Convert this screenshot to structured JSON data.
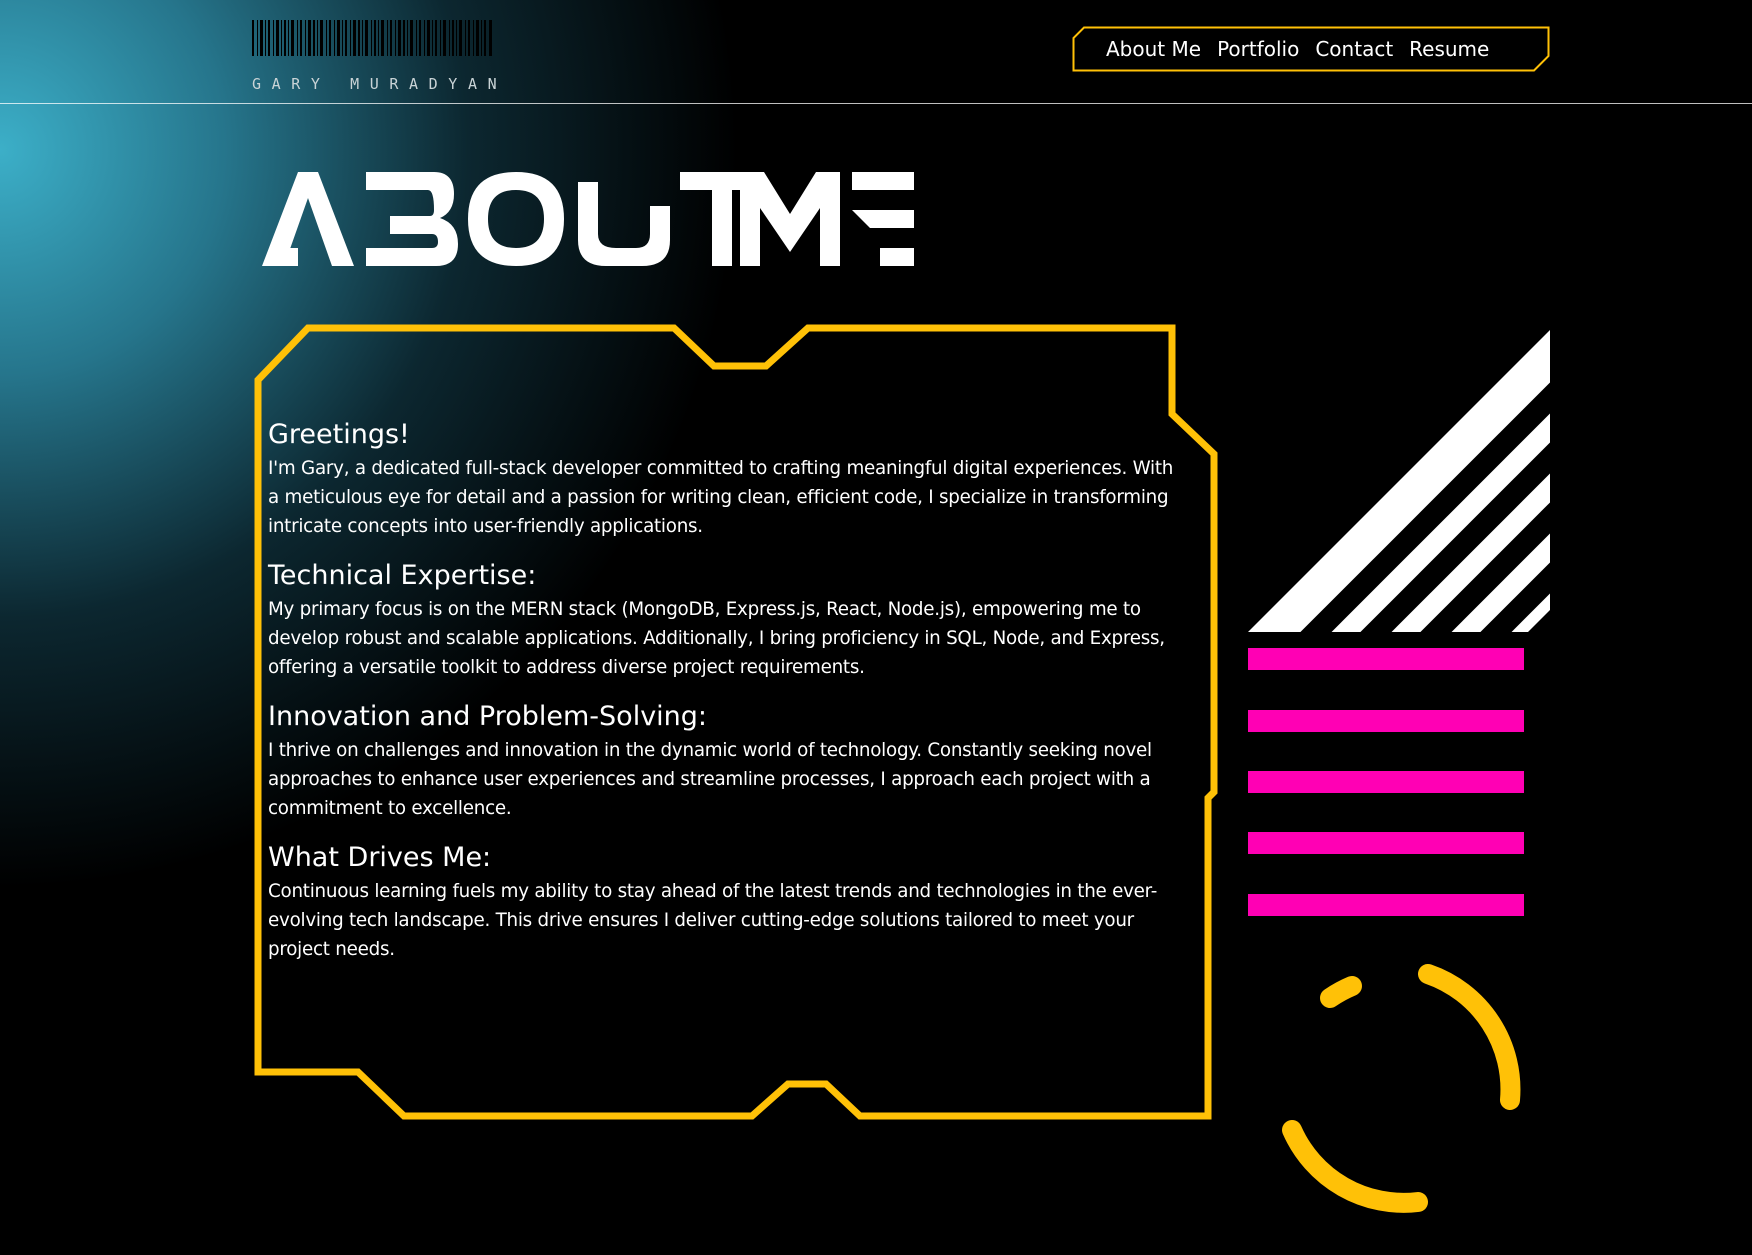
{
  "header": {
    "logo_name": "GARY MURADYAN",
    "nav": [
      {
        "label": "About Me"
      },
      {
        "label": "Portfolio"
      },
      {
        "label": "Contact"
      },
      {
        "label": "Resume"
      }
    ]
  },
  "page": {
    "title": "ABOUT ME"
  },
  "sections": [
    {
      "heading": "Greetings!",
      "body": "I'm Gary, a dedicated full-stack developer committed to crafting meaningful digital experiences. With a meticulous eye for detail and a passion for writing clean, efficient code, I specialize in transforming intricate concepts into user-friendly applications."
    },
    {
      "heading": "Technical Expertise:",
      "body": "My primary focus is on the MERN stack (MongoDB, Express.js, React, Node.js), empowering me to develop robust and scalable applications. Additionally, I bring proficiency in SQL, Node, and Express, offering a versatile toolkit to address diverse project requirements."
    },
    {
      "heading": "Innovation and Problem-Solving:",
      "body": "I thrive on challenges and innovation in the dynamic world of technology. Constantly seeking novel approaches to enhance user experiences and streamline processes, I approach each project with a commitment to excellence."
    },
    {
      "heading": "What Drives Me:",
      "body": "Continuous learning fuels my ability to stay ahead of the latest trends and technologies in the ever-evolving tech landscape. This drive ensures I deliver cutting-edge solutions tailored to meet your project needs."
    }
  ],
  "colors": {
    "accent_yellow": "#ffc107",
    "accent_magenta": "#ff00b4",
    "background": "#000000",
    "gradient_teal": "#3cafc8",
    "text": "#ffffff"
  }
}
